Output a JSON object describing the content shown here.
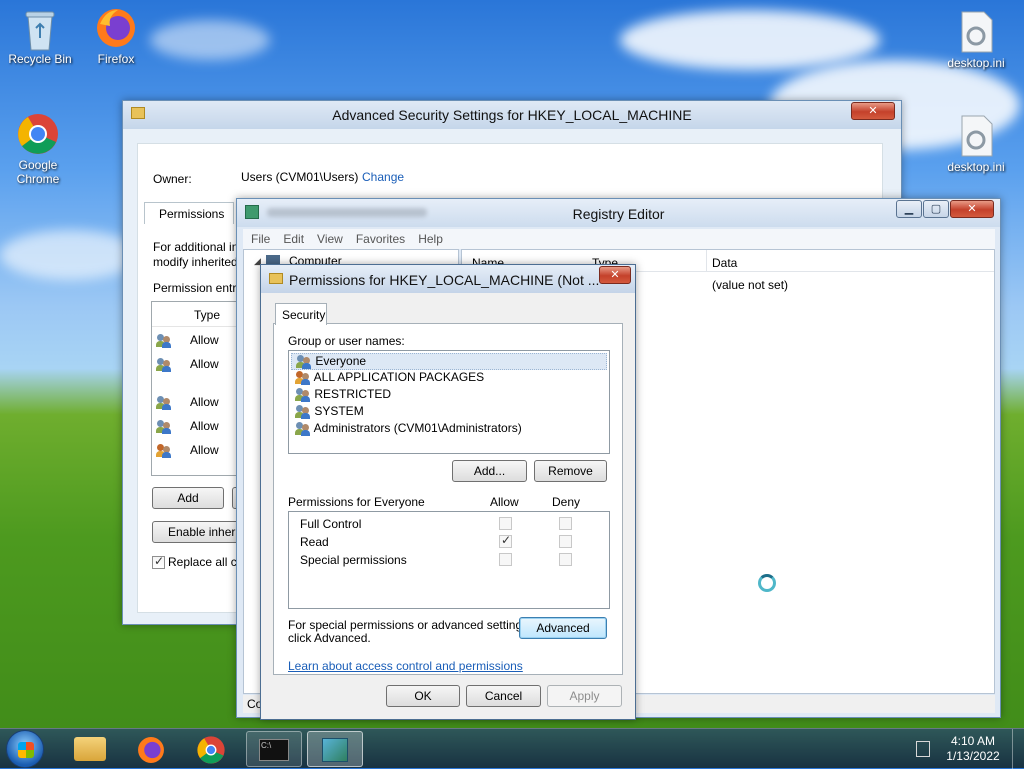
{
  "desktop": {
    "icons": [
      {
        "label": "Recycle Bin",
        "icon": "recycle-bin-icon"
      },
      {
        "label": "Firefox",
        "icon": "firefox-icon"
      },
      {
        "label": "Google Chrome",
        "icon": "chrome-icon"
      },
      {
        "label": "desktop.ini",
        "icon": "settings-file-icon"
      },
      {
        "label": "desktop.ini",
        "icon": "settings-file-icon"
      }
    ]
  },
  "advanced_security": {
    "title": "Advanced Security Settings for HKEY_LOCAL_MACHINE",
    "owner_label": "Owner:",
    "owner_value": "Users (CVM01\\Users)",
    "change_link": "Change",
    "tab_permissions": "Permissions",
    "info_text_1": "For additional in",
    "info_text_2": "modify inherited",
    "entries_label": "Permission entri",
    "type_header": "Type",
    "rows": [
      "Allow",
      "Allow",
      "Allow",
      "Allow",
      "Allow"
    ],
    "add_button": "Add",
    "enable_inheritance_button": "Enable inheri",
    "replace_checkbox_label": "Replace all ch"
  },
  "registry_editor": {
    "title": "Registry Editor",
    "menu": [
      "File",
      "Edit",
      "View",
      "Favorites",
      "Help"
    ],
    "tree_root": "Computer",
    "columns": {
      "name": "Name",
      "type": "Type",
      "data": "Data"
    },
    "value_data": "(value not set)",
    "status_text": "Co"
  },
  "permissions_dialog": {
    "title": "Permissions for HKEY_LOCAL_MACHINE (Not ...",
    "tab_security": "Security",
    "group_label": "Group or user names:",
    "users": [
      "Everyone",
      "ALL APPLICATION PACKAGES",
      "RESTRICTED",
      "SYSTEM",
      "Administrators (CVM01\\Administrators)"
    ],
    "add_button": "Add...",
    "remove_button": "Remove",
    "permissions_for": "Permissions for Everyone",
    "allow_header": "Allow",
    "deny_header": "Deny",
    "permissions": [
      {
        "name": "Full Control",
        "allow": false,
        "deny": false
      },
      {
        "name": "Read",
        "allow": true,
        "deny": false
      },
      {
        "name": "Special permissions",
        "allow": false,
        "deny": false
      }
    ],
    "special_text_1": "For special permissions or advanced settings,",
    "special_text_2": "click Advanced.",
    "advanced_button": "Advanced",
    "learn_link": "Learn about access control and permissions",
    "ok_button": "OK",
    "cancel_button": "Cancel",
    "apply_button": "Apply"
  },
  "taskbar": {
    "time": "4:10 AM",
    "date": "1/13/2022",
    "items": [
      "file-explorer-icon",
      "firefox-icon",
      "chrome-icon",
      "command-prompt-icon",
      "registry-editor-icon"
    ]
  },
  "colors": {
    "link": "#1a5eb8",
    "selection": "#dde8f5"
  }
}
